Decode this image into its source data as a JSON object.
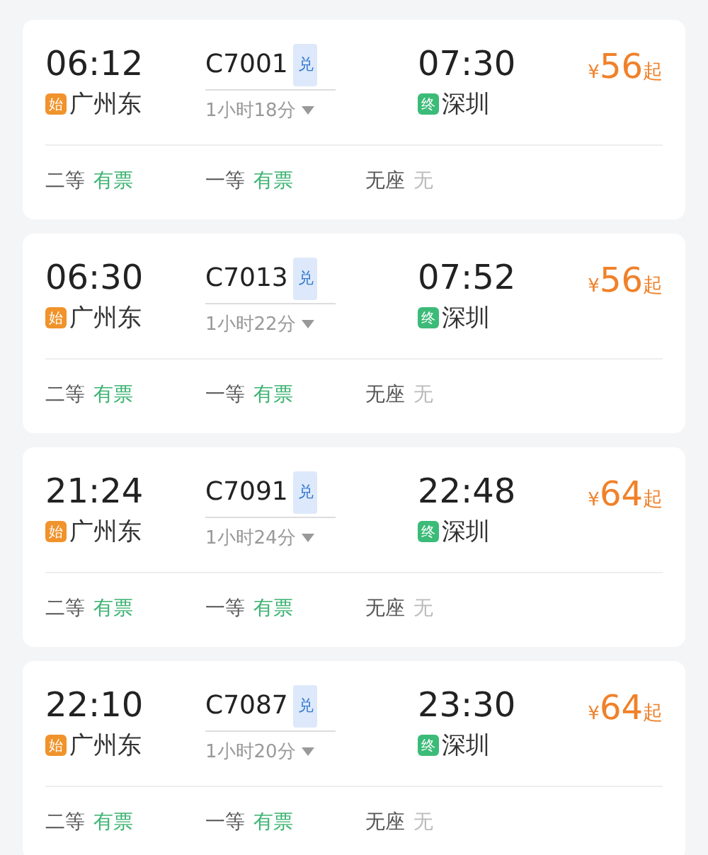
{
  "trains": [
    {
      "depart_time": "06:12",
      "train_no": "兑",
      "code": "C7001",
      "arrive_time": "07:30",
      "price_symbol": "¥",
      "price": "56",
      "price_suffix": "起",
      "from": {
        "badge": "始",
        "kind": "start",
        "name": "广州东"
      },
      "duration": "1小时18分",
      "to": {
        "badge": "终",
        "kind": "end",
        "name": "深圳"
      },
      "seats": [
        {
          "class": "二等",
          "status": "有票",
          "available": true
        },
        {
          "class": "一等",
          "status": "有票",
          "available": true
        },
        {
          "class": "无座",
          "status": "无",
          "available": false
        }
      ]
    },
    {
      "depart_time": "06:30",
      "train_no": "兑",
      "code": "C7013",
      "arrive_time": "07:52",
      "price_symbol": "¥",
      "price": "56",
      "price_suffix": "起",
      "from": {
        "badge": "始",
        "kind": "start",
        "name": "广州东"
      },
      "duration": "1小时22分",
      "to": {
        "badge": "终",
        "kind": "end",
        "name": "深圳"
      },
      "seats": [
        {
          "class": "二等",
          "status": "有票",
          "available": true
        },
        {
          "class": "一等",
          "status": "有票",
          "available": true
        },
        {
          "class": "无座",
          "status": "无",
          "available": false
        }
      ]
    },
    {
      "depart_time": "21:24",
      "train_no": "兑",
      "code": "C7091",
      "arrive_time": "22:48",
      "price_symbol": "¥",
      "price": "64",
      "price_suffix": "起",
      "from": {
        "badge": "始",
        "kind": "start",
        "name": "广州东"
      },
      "duration": "1小时24分",
      "to": {
        "badge": "终",
        "kind": "end",
        "name": "深圳"
      },
      "seats": [
        {
          "class": "二等",
          "status": "有票",
          "available": true
        },
        {
          "class": "一等",
          "status": "有票",
          "available": true
        },
        {
          "class": "无座",
          "status": "无",
          "available": false
        }
      ]
    },
    {
      "depart_time": "22:10",
      "train_no": "兑",
      "code": "C7087",
      "arrive_time": "23:30",
      "price_symbol": "¥",
      "price": "64",
      "price_suffix": "起",
      "from": {
        "badge": "始",
        "kind": "start",
        "name": "广州东"
      },
      "duration": "1小时20分",
      "to": {
        "badge": "终",
        "kind": "end",
        "name": "深圳"
      },
      "seats": [
        {
          "class": "二等",
          "status": "有票",
          "available": true
        },
        {
          "class": "一等",
          "status": "有票",
          "available": true
        },
        {
          "class": "无座",
          "status": "无",
          "available": false
        }
      ]
    }
  ]
}
